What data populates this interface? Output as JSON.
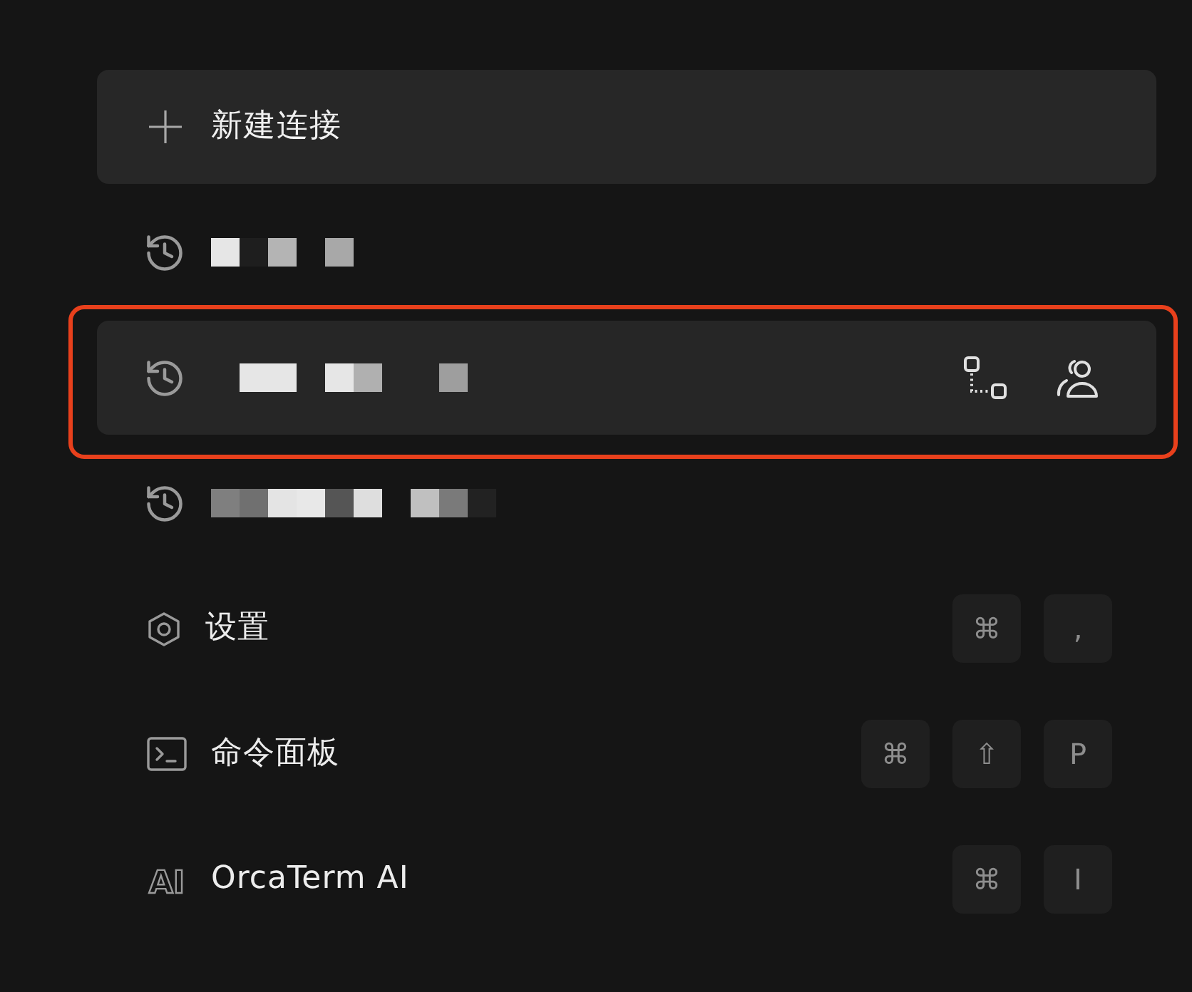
{
  "new_connection_button": {
    "label": "新建连接"
  },
  "history": [
    {
      "selected": false,
      "highlighted": false
    },
    {
      "selected": true,
      "highlighted": true
    },
    {
      "selected": false,
      "highlighted": false
    }
  ],
  "menu": [
    {
      "kind": "settings",
      "label": "设置",
      "keys": [
        "⌘",
        ","
      ]
    },
    {
      "kind": "command_palette",
      "label": "命令面板",
      "keys": [
        "⌘",
        "⇧",
        "P"
      ]
    },
    {
      "kind": "ai",
      "label": "OrcaTerm AI",
      "icon_text": "AI",
      "keys": [
        "⌘",
        "I"
      ]
    }
  ]
}
